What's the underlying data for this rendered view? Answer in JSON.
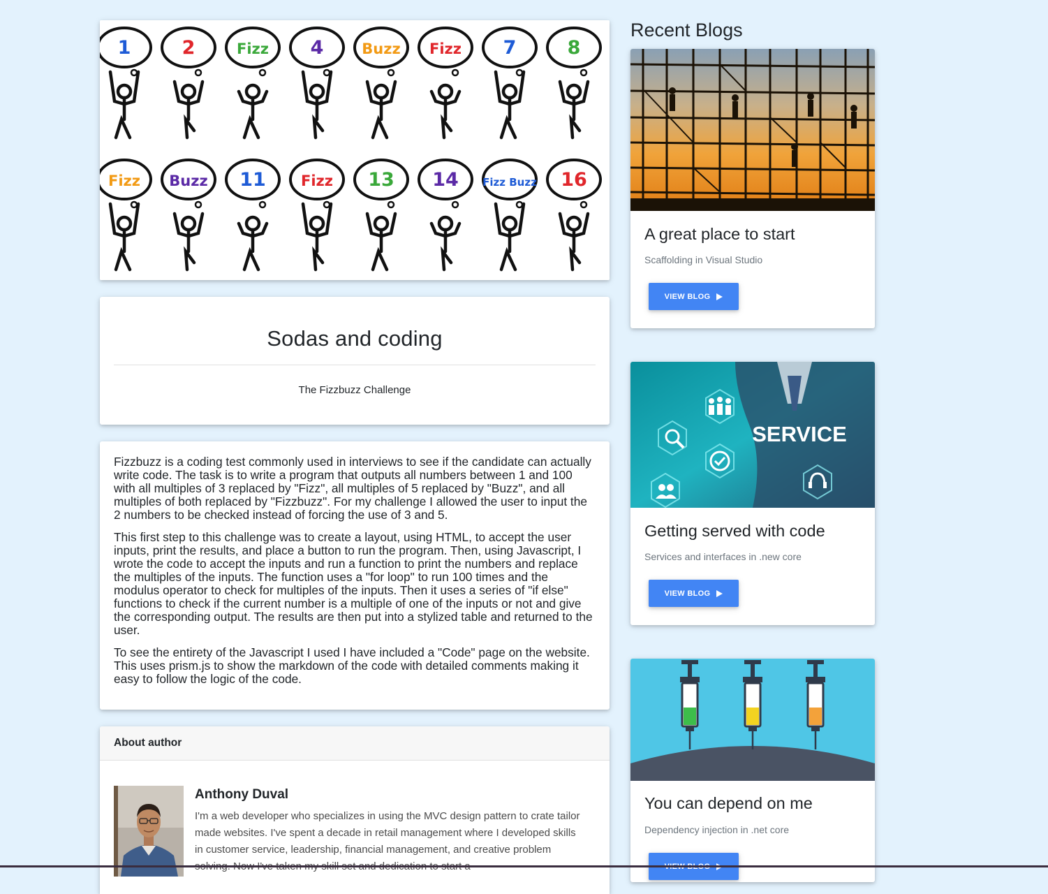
{
  "hero": {
    "bubbles_row1": [
      "1",
      "2",
      "Fizz",
      "4",
      "Buzz",
      "Fizz",
      "7",
      "8"
    ],
    "bubbles_row2": [
      "Fizz",
      "Buzz",
      "11",
      "Fizz",
      "13",
      "14",
      "Fizz Buzz",
      "16"
    ]
  },
  "post": {
    "title": "Sodas and coding",
    "subtitle": "The Fizzbuzz Challenge",
    "paragraphs": [
      "Fizzbuzz is a coding test commonly used in interviews to see if the candidate can actually write code. The task is to write a program that outputs all numbers between 1 and 100 with all multiples of 3 replaced by \"Fizz\", all multiples of 5 replaced by \"Buzz\", and all multiples of both replaced by \"Fizzbuzz\". For my challenge I allowed the user to input the 2 numbers to be checked instead of forcing the use of 3 and 5.",
      "This first step to this challenge was to create a layout, using HTML, to accept the user inputs, print the results, and place a button to run the program. Then, using Javascript, I wrote the code to accept the inputs and run a function to print the numbers and replace the multiples of the inputs. The function uses a \"for loop\" to run 100 times and the modulus operator to check for multiples of the inputs. Then it uses a series of \"if else\" functions to check if the current number is a multiple of one of the inputs or not and give the corresponding output. The results are then put into a stylized table and returned to the user.",
      "To see the entirety of the Javascript I used I have included a \"Code\" page on the website. This uses prism.js to show the markdown of the code with detailed comments making it easy to follow the logic of the code."
    ]
  },
  "author": {
    "header": "About author",
    "name": "Anthony Duval",
    "bio": "I'm a web developer who specializes in using the MVC design pattern to crate tailor made websites. I've spent a decade in retail management where I developed skills in customer service, leadership, financial management, and creative problem solving. Now I've taken my skill set and dedication to start a"
  },
  "sidebar": {
    "title": "Recent Blogs",
    "blogs": [
      {
        "title": "A great place to start",
        "subtitle": "Scaffolding in Visual Studio",
        "button": "VIEW BLOG"
      },
      {
        "title": "Getting served with code",
        "subtitle": "Services and interfaces in .new core",
        "button": "VIEW BLOG",
        "image_text": "SERVICE"
      },
      {
        "title": "You can depend on me",
        "subtitle": "Dependency injection in .net core",
        "button": "VIEW BLOG"
      }
    ]
  }
}
